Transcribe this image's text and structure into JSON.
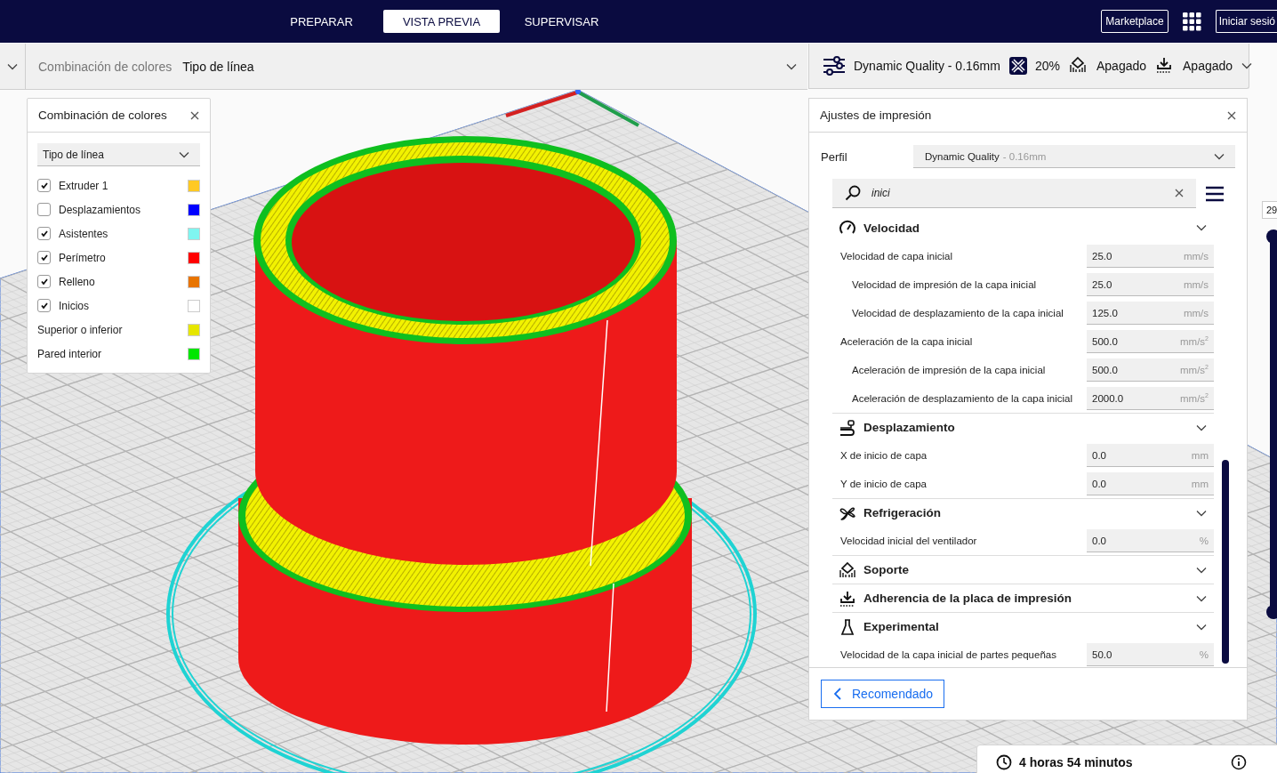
{
  "header": {
    "tabs": [
      {
        "label": "PREPARAR",
        "selected": false
      },
      {
        "label": "VISTA PREVIA",
        "selected": true
      },
      {
        "label": "SUPERVISAR",
        "selected": false
      }
    ],
    "marketplace": "Marketplace",
    "sign_in": "Iniciar sesió"
  },
  "view_bar": {
    "label": "Combinación de colores",
    "value": "Tipo de línea"
  },
  "print_summary": {
    "profile": "Dynamic Quality - 0.16mm",
    "infill": "20%",
    "support": "Apagado",
    "adhesion": "Apagado"
  },
  "legend": {
    "title": "Combinación de colores",
    "dropdown": "Tipo de línea",
    "items": [
      {
        "label": "Extruder 1",
        "kind": "checkbox",
        "checked": true,
        "color": "#ffc924"
      },
      {
        "label": "Desplazamientos",
        "kind": "checkbox",
        "checked": false,
        "color": "#0000ff"
      },
      {
        "label": "Asistentes",
        "kind": "checkbox",
        "checked": true,
        "color": "#7ff5f0"
      },
      {
        "label": "Perímetro",
        "kind": "checkbox",
        "checked": true,
        "color": "#ff0000"
      },
      {
        "label": "Relleno",
        "kind": "checkbox",
        "checked": true,
        "color": "#e87400"
      },
      {
        "label": "Inicios",
        "kind": "checkbox",
        "checked": true,
        "color": "#ffffff"
      },
      {
        "label": "Superior o inferior",
        "kind": "plain",
        "color": "#e6e600"
      },
      {
        "label": "Pared interior",
        "kind": "plain",
        "color": "#00e600"
      }
    ]
  },
  "settings": {
    "title": "Ajustes de impresión",
    "profile_label": "Perfil",
    "profile_name": "Dynamic Quality",
    "profile_detail": "- 0.16mm",
    "search_value": "inici",
    "categories": [
      {
        "title": "Velocidad",
        "kind": "speed",
        "settings": [
          {
            "label": "Velocidad de capa inicial",
            "value": "25.0",
            "unit": "mm/s",
            "children": [
              {
                "label": "Velocidad de impresión de la capa inicial",
                "value": "25.0",
                "unit": "mm/s"
              },
              {
                "label": "Velocidad de desplazamiento de la capa inicial",
                "value": "125.0",
                "unit": "mm/s"
              }
            ]
          },
          {
            "label": "Aceleración de la capa inicial",
            "value": "500.0",
            "unit": "mm/s$^{2}$",
            "children": [
              {
                "label": "Aceleración de impresión de la capa inicial",
                "value": "500.0",
                "unit": "mm/s$^{2}$"
              },
              {
                "label": "Aceleración de desplazamiento de la capa inicial",
                "value": "2000.0",
                "unit": "mm/s$^{2}$"
              }
            ]
          }
        ]
      },
      {
        "title": "Desplazamiento",
        "kind": "travel",
        "settings": [
          {
            "label": "X de inicio de capa",
            "value": "0.0",
            "unit": "mm"
          },
          {
            "label": "Y de inicio de capa",
            "value": "0.0",
            "unit": "mm"
          }
        ]
      },
      {
        "title": "Refrigeración",
        "kind": "cooling",
        "settings": [
          {
            "label": "Velocidad inicial del ventilador",
            "value": "0.0",
            "unit": "%"
          }
        ]
      },
      {
        "title": "Soporte",
        "kind": "support"
      },
      {
        "title": "Adherencia de la placa de impresión",
        "kind": "adhesion"
      },
      {
        "title": "Experimental",
        "kind": "experimental",
        "settings": [
          {
            "label": "Velocidad de la capa inicial de partes pequeñas",
            "value": "50.0",
            "unit": "%"
          }
        ]
      }
    ],
    "recommended_button": "Recomendado"
  },
  "layer_slider": {
    "label": "29",
    "handles": [
      {
        "level": 1
      },
      {
        "level": 0
      }
    ]
  },
  "estimate": {
    "time": "4 horas 54 minutos"
  }
}
